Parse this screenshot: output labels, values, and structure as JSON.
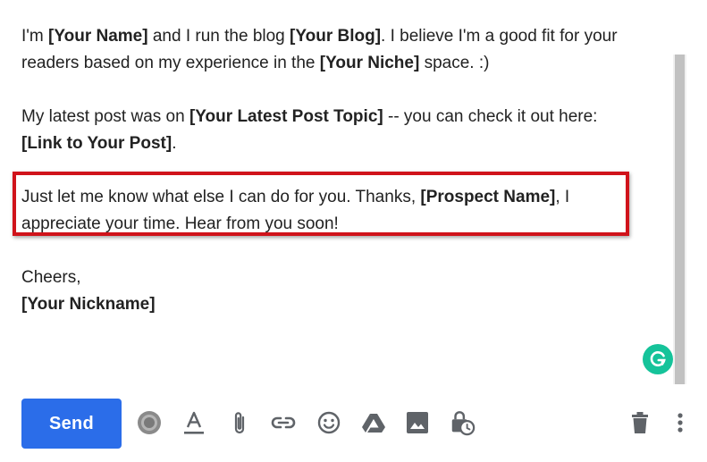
{
  "email": {
    "p1": {
      "t1": "I'm ",
      "b1": "[Your Name]",
      "t2": " and I run the blog ",
      "b2": "[Your Blog]",
      "t3": ". I believe I'm a good fit for your",
      "t4": "readers based on my experience in the ",
      "b3": "[Your Niche]",
      "t5": " space. :)"
    },
    "p2": {
      "t1": "My latest post was on ",
      "b1": "[Your Latest Post Topic]",
      "t2": " -- you can check it out here:",
      "b2": "[Link to Your Post]",
      "t3": "."
    },
    "p3": {
      "t1": "Just let me know what else I can do for you. Thanks, ",
      "b1": "[Prospect Name]",
      "t2": ", I",
      "t3": "appreciate your time. Hear from you soon!"
    },
    "p4": {
      "t1": "Cheers,",
      "b1": "[Your Nickname]"
    }
  },
  "toolbar": {
    "send_label": "Send",
    "icons": [
      "extension-icon",
      "format-text-icon",
      "attach-icon",
      "link-icon",
      "emoji-icon",
      "drive-icon",
      "photo-icon",
      "confidential-mode-icon",
      "trash-icon",
      "more-options-icon"
    ]
  },
  "colors": {
    "send_button": "#2b6de9",
    "highlight_border": "#d0131b",
    "grammarly": "#15c39a",
    "icon": "#5f6368"
  }
}
